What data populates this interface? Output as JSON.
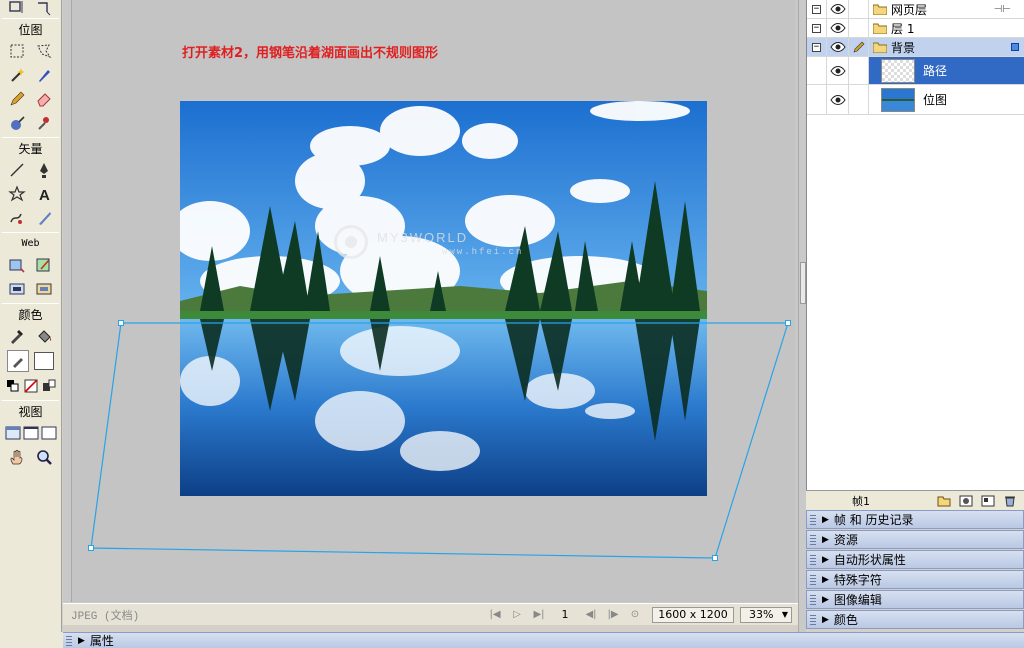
{
  "toolbox": {
    "sections": {
      "bitmap": "位图",
      "vector": "矢量",
      "web": "Web",
      "colors": "颜色",
      "view": "视图"
    }
  },
  "document": {
    "hint": "打开素材2，用钢笔沿着湖面画出不规则图形",
    "watermark": "MY3WORLD",
    "watermark_url": "www.hfei.cn"
  },
  "status": {
    "file_type": "JPEG (文档)",
    "frame": "1",
    "size": "1600 x 1200",
    "zoom": "33%"
  },
  "layers": {
    "rows": [
      {
        "name": "网页层"
      },
      {
        "name": "层 1"
      },
      {
        "name": "背景"
      },
      {
        "name": "路径"
      },
      {
        "name": "位图"
      }
    ],
    "footer_frame": "帧1"
  },
  "panels": [
    {
      "label": "帧 和 历史记录"
    },
    {
      "label": "资源"
    },
    {
      "label": "自动形状属性"
    },
    {
      "label": "特殊字符"
    },
    {
      "label": "图像编辑"
    },
    {
      "label": "颜色"
    }
  ],
  "properties": {
    "label": "属性"
  },
  "colors": {
    "hint_red": "#e02020",
    "selection_blue": "#316ac5",
    "path_cyan": "#29a3e6"
  }
}
